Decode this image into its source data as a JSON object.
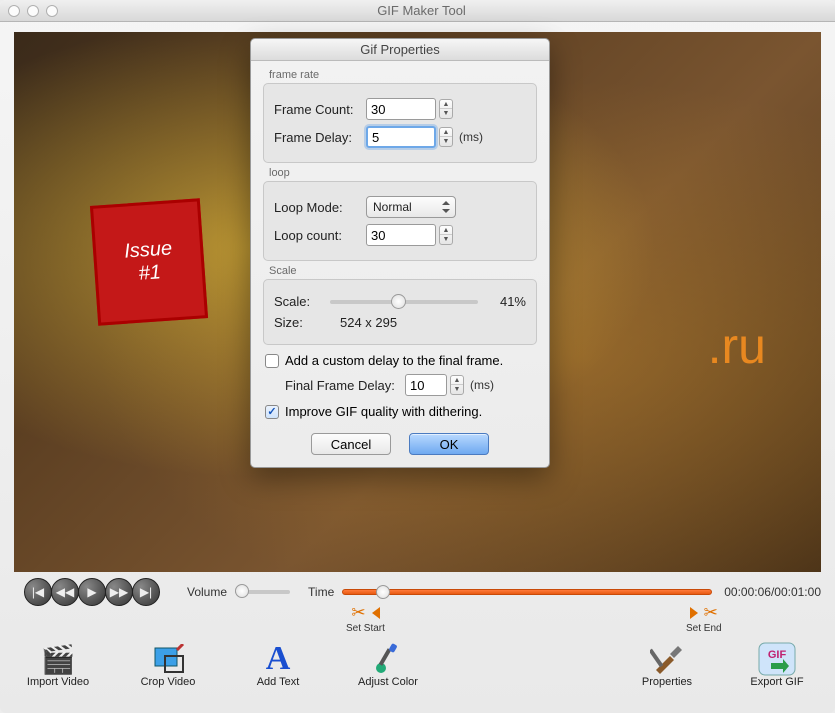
{
  "window": {
    "title": "GIF Maker Tool"
  },
  "video_overlay": {
    "issue_line1": "Issue",
    "issue_line2": "#1",
    "watermark": ".ru"
  },
  "dialog": {
    "title": "Gif Properties",
    "frame_rate": {
      "group": "frame rate",
      "count_label": "Frame Count:",
      "count_value": "30",
      "delay_label": "Frame Delay:",
      "delay_value": "5",
      "delay_unit": "(ms)"
    },
    "loop": {
      "group": "loop",
      "mode_label": "Loop Mode:",
      "mode_value": "Normal",
      "count_label": "Loop count:",
      "count_value": "30"
    },
    "scale": {
      "group": "Scale",
      "scale_label": "Scale:",
      "scale_pct": "41%",
      "scale_value_0_1": 0.41,
      "size_label": "Size:",
      "size_value": "524 x 295"
    },
    "final_frame": {
      "add_custom_label": "Add a custom delay to the final frame.",
      "add_custom_checked": false,
      "delay_label": "Final Frame Delay:",
      "delay_value": "10",
      "delay_unit": "(ms)"
    },
    "dither": {
      "label": "Improve GIF quality with dithering.",
      "checked": true
    },
    "buttons": {
      "cancel": "Cancel",
      "ok": "OK"
    }
  },
  "controls": {
    "volume_label": "Volume",
    "volume_0_1": 0.0,
    "time_label": "Time",
    "time_pos_0_1": 0.09,
    "time_current": "00:00:06",
    "time_total": "00:01:00",
    "set_start": "Set Start",
    "set_end": "Set End"
  },
  "toolbar": {
    "import": "Import Video",
    "crop": "Crop Video",
    "add_text": "Add Text",
    "adjust_color": "Adjust Color",
    "properties": "Properties",
    "export": "Export GIF"
  }
}
